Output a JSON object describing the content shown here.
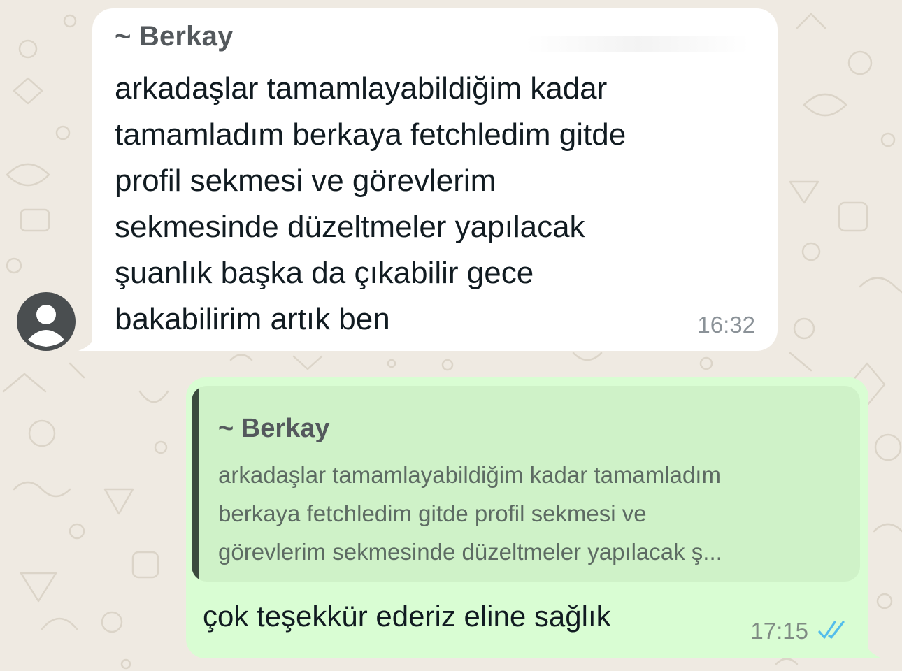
{
  "chat": {
    "incoming": {
      "sender": "~ Berkay",
      "lines": [
        "arkadaşlar tamamlayabildiğim kadar",
        "tamamladım berkaya fetchledim gitde",
        "profil sekmesi ve görevlerim",
        "sekmesinde düzeltmeler yapılacak",
        "şuanlık başka da çıkabilir gece",
        "bakabilirim artık ben"
      ],
      "time": "16:32",
      "avatar_icon": "person-icon"
    },
    "outgoing": {
      "quoted_sender": "~ Berkay",
      "quoted_lines": [
        "arkadaşlar tamamlayabildiğim kadar tamamladım",
        "berkaya fetchledim gitde profil sekmesi ve",
        "görevlerim sekmesinde düzeltmeler yapılacak ş..."
      ],
      "text": "çok teşekkür ederiz eline sağlık",
      "time": "17:15",
      "status_icon": "double-check-icon",
      "status": "read"
    }
  },
  "colors": {
    "wallpaper": "#efeae2",
    "incoming_bubble": "#ffffff",
    "outgoing_bubble": "#d9fdd3",
    "quote_background": "#cff2c8",
    "read_ticks": "#53bdeb",
    "avatar": "#4a4e50"
  }
}
